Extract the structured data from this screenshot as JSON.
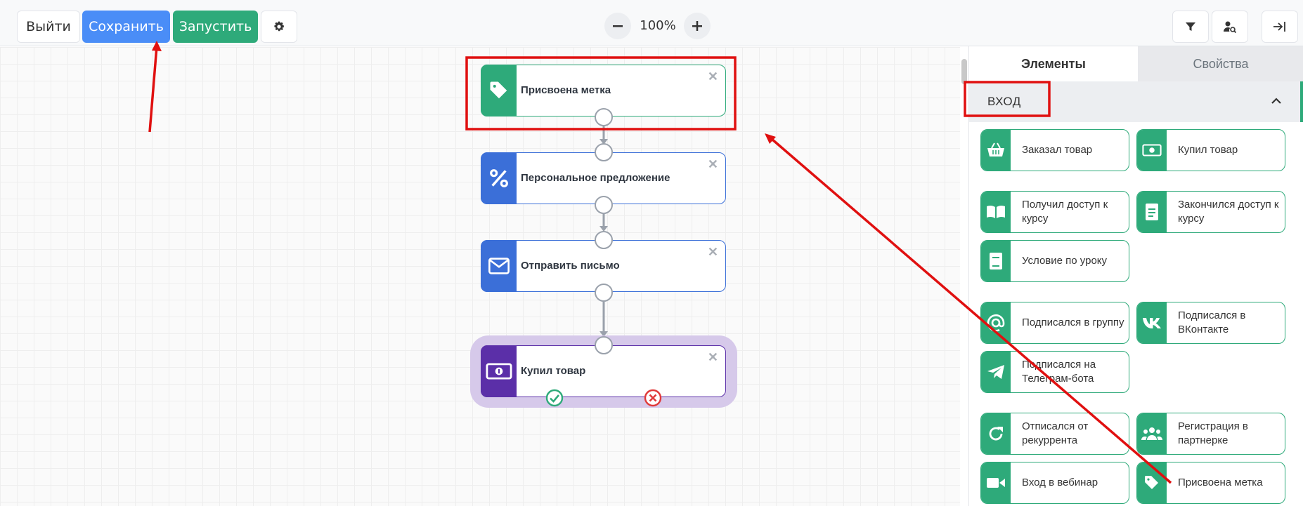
{
  "toolbar": {
    "exit_label": "Выйти",
    "save_label": "Сохранить",
    "run_label": "Запустить",
    "zoom_value": "100%"
  },
  "nodes": [
    {
      "label": "Присвоена метка",
      "color": "#2eaa7a",
      "icon": "tag-icon"
    },
    {
      "label": "Персональное предложение",
      "color": "#3b6fd8",
      "icon": "percent-icon"
    },
    {
      "label": "Отправить письмо",
      "color": "#3b6fd8",
      "icon": "envelope-icon"
    },
    {
      "label": "Купил товар",
      "color": "#5b2fa8",
      "icon": "banknote-icon"
    }
  ],
  "panel": {
    "tabs": [
      "Элементы",
      "Свойства"
    ],
    "active_tab": "Элементы",
    "section_title": "ВХОД",
    "elements": [
      {
        "label": "Заказал товар",
        "icon": "basket-icon"
      },
      {
        "label": "Купил товар",
        "icon": "banknote-icon"
      },
      {
        "label": "Получил доступ к курсу",
        "icon": "book-open-icon"
      },
      {
        "label": "Закончился доступ к курсу",
        "icon": "document-icon"
      },
      {
        "label": "Условие по уроку",
        "icon": "book-icon"
      },
      {
        "label": "Подписался в группу",
        "icon": "at-icon"
      },
      {
        "label": "Подписался в ВКонтакте",
        "icon": "vk-icon"
      },
      {
        "label": "Подписался на Телеграм-бота",
        "icon": "telegram-icon"
      },
      {
        "label": "Отписался от рекуррента",
        "icon": "refresh-icon"
      },
      {
        "label": "Регистрация в партнерке",
        "icon": "users-icon"
      },
      {
        "label": "Вход в вебинар",
        "icon": "video-icon"
      },
      {
        "label": "Присвоена метка",
        "icon": "tag-icon"
      }
    ]
  },
  "colors": {
    "accent_green": "#2eaa7a",
    "save_blue": "#4a8df7",
    "annotation_red": "#e01010",
    "node_blue": "#3b6fd8",
    "node_purple": "#5b2fa8"
  }
}
